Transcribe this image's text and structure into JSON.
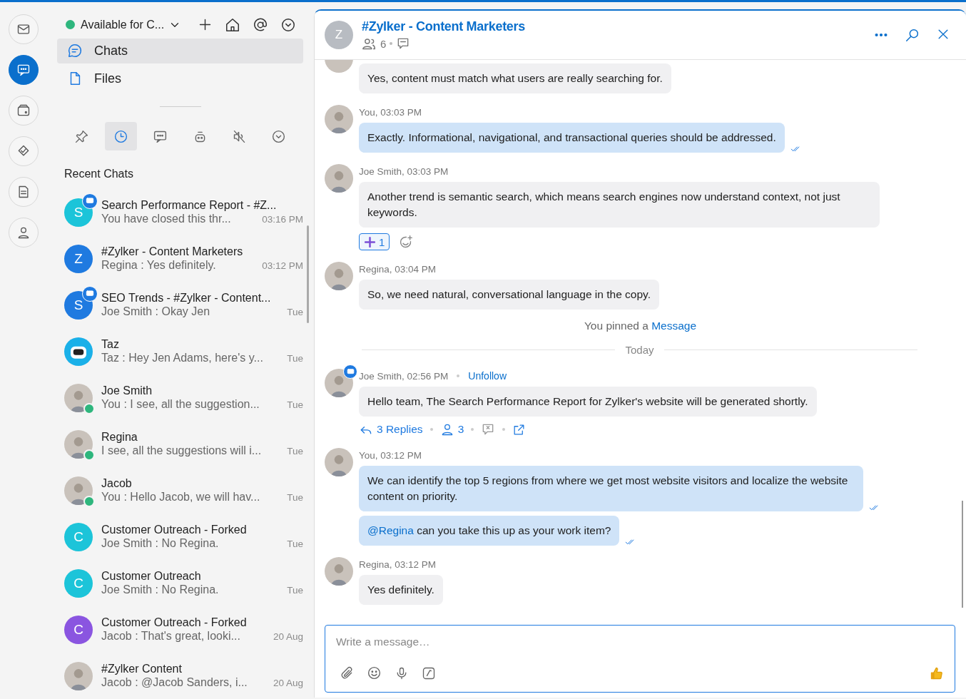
{
  "rail": [
    {
      "kind": "mail",
      "selected": false
    },
    {
      "kind": "chat",
      "selected": true
    },
    {
      "kind": "wallet",
      "selected": false
    },
    {
      "kind": "tasks",
      "selected": false
    },
    {
      "kind": "notes",
      "selected": false
    },
    {
      "kind": "contacts",
      "selected": false
    }
  ],
  "status": {
    "label": "Available for C..."
  },
  "nav": [
    {
      "kind": "chats",
      "label": "Chats",
      "selected": true
    },
    {
      "kind": "files",
      "label": "Files",
      "selected": false
    }
  ],
  "filters": [
    {
      "kind": "pin",
      "selected": false
    },
    {
      "kind": "recent",
      "selected": true
    },
    {
      "kind": "chat",
      "selected": false
    },
    {
      "kind": "bot",
      "selected": false
    },
    {
      "kind": "muted",
      "selected": false
    },
    {
      "kind": "more",
      "selected": false
    }
  ],
  "section_title": "Recent Chats",
  "chats": [
    {
      "title": "Search Performance Report - #Z...",
      "preview": "You have closed this thr...",
      "time": "03:16 PM",
      "avatar": {
        "kind": "letter",
        "letter": "S",
        "color": "#1cc4d9"
      },
      "thread_badge": true,
      "online": false
    },
    {
      "title": "#Zylker - Content Marketers",
      "preview": "Regina : Yes definitely.",
      "time": "03:12 PM",
      "avatar": {
        "kind": "letter",
        "letter": "Z",
        "color": "#1f7ae0"
      },
      "thread_badge": false,
      "online": false
    },
    {
      "title": "SEO Trends - #Zylker - Content...",
      "preview": "Joe Smith : Okay Jen",
      "time": "Tue",
      "avatar": {
        "kind": "letter",
        "letter": "S",
        "color": "#1f7ae0"
      },
      "thread_badge": true,
      "online": false
    },
    {
      "title": "Taz",
      "preview": "Taz : Hey Jen Adams, here's y...",
      "time": "Tue",
      "avatar": {
        "kind": "bot"
      },
      "thread_badge": false,
      "online": false
    },
    {
      "title": "Joe Smith",
      "preview": "You : I see, all the suggestion...",
      "time": "Tue",
      "avatar": {
        "kind": "photo"
      },
      "thread_badge": false,
      "online": true
    },
    {
      "title": "Regina",
      "preview": "I see, all the suggestions will i...",
      "time": "Tue",
      "avatar": {
        "kind": "photo"
      },
      "thread_badge": false,
      "online": true
    },
    {
      "title": "Jacob",
      "preview": "You : Hello Jacob, we will hav...",
      "time": "Tue",
      "avatar": {
        "kind": "photo"
      },
      "thread_badge": false,
      "online": true
    },
    {
      "title": "Customer Outreach - Forked",
      "preview": "Joe Smith : No Regina.",
      "time": "Tue",
      "avatar": {
        "kind": "letter",
        "letter": "C",
        "color": "#1cc4d9"
      },
      "thread_badge": false,
      "online": false
    },
    {
      "title": "Customer Outreach",
      "preview": "Joe Smith : No Regina.",
      "time": "Tue",
      "avatar": {
        "kind": "letter",
        "letter": "C",
        "color": "#1cc4d9"
      },
      "thread_badge": false,
      "online": false
    },
    {
      "title": "Customer Outreach - Forked",
      "preview": "Jacob : That's great, looki...",
      "time": "20 Aug",
      "avatar": {
        "kind": "letter",
        "letter": "C",
        "color": "#8a55e0"
      },
      "thread_badge": false,
      "online": false
    },
    {
      "title": "#Zylker Content",
      "preview": "Jacob : @Jacob Sanders, i...",
      "time": "20 Aug",
      "avatar": {
        "kind": "photo"
      },
      "thread_badge": false,
      "online": false
    }
  ],
  "conversation": {
    "avatar_letter": "Z",
    "title": "#Zylker - Content Marketers",
    "member_count": "6",
    "items": [
      {
        "kind": "message",
        "bubbles": [
          {
            "text": "Yes, content must match what users are really searching for.",
            "mine": false
          }
        ]
      },
      {
        "kind": "message",
        "sender": "You, 03:03 PM",
        "bubbles": [
          {
            "text": "Exactly. Informational, navigational, and transactional queries should be addressed.",
            "mine": true
          }
        ]
      },
      {
        "kind": "message",
        "sender": "Joe Smith, 03:03 PM",
        "bubbles": [
          {
            "text": "Another trend is semantic search, which means search engines now understand context, not just keywords.",
            "mine": false
          }
        ],
        "reaction_count": "1"
      },
      {
        "kind": "message",
        "sender": "Regina, 03:04 PM",
        "bubbles": [
          {
            "text": "So, we need natural, conversational language in the copy.",
            "mine": false
          }
        ]
      },
      {
        "kind": "notice",
        "text": "You pinned a",
        "link": "Message"
      },
      {
        "kind": "divider",
        "label": "Today"
      },
      {
        "kind": "message",
        "sender": "Joe Smith, 02:56 PM",
        "thread_badge": true,
        "follow": "Unfollow",
        "bubbles": [
          {
            "text": "Hello team, The Search Performance Report for Zylker's website will be generated shortly.",
            "mine": false
          }
        ],
        "thread": {
          "replies": "3 Replies",
          "participants": "3"
        }
      },
      {
        "kind": "message",
        "sender": "You, 03:12 PM",
        "bubbles": [
          {
            "text": "We can identify the top 5 regions from where we get most website visitors and localize the website content on priority.",
            "mine": true
          },
          {
            "mention": "@Regina",
            "text": "can you take this up as your work item?",
            "mine": true
          }
        ]
      },
      {
        "kind": "message",
        "sender": "Regina, 03:12 PM",
        "bubbles": [
          {
            "text": "Yes definitely.",
            "mine": false
          }
        ]
      }
    ],
    "composer": {
      "placeholder": "Write a message…"
    }
  }
}
